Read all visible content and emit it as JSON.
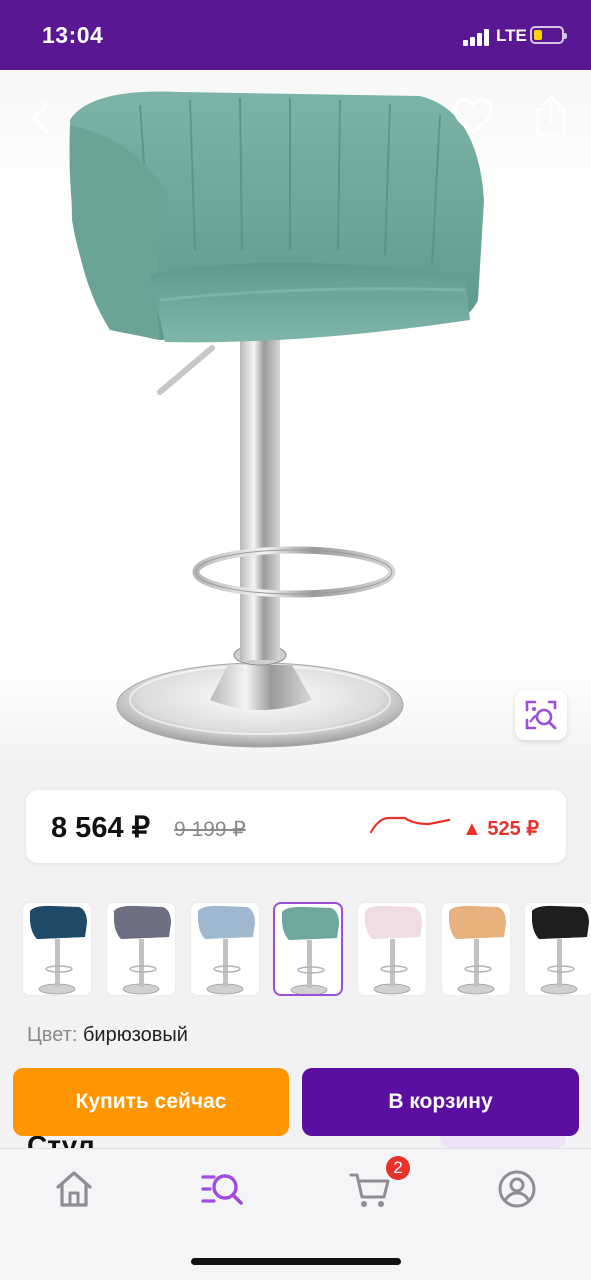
{
  "status_bar": {
    "time": "13:04",
    "network": "LTE",
    "battery_level": 0.25,
    "battery_color": "#f7d500",
    "icons": [
      "signal-icon",
      "battery-icon"
    ]
  },
  "header": {
    "background": "#5a1794",
    "icons": [
      "chevron-left-icon",
      "heart-icon",
      "share-icon",
      "visual-search-icon"
    ]
  },
  "price": {
    "current": "8 564 ₽",
    "old": "9 199 ₽",
    "difference": "▲ 525 ₽",
    "trend_color": "#e8322c"
  },
  "variants": [
    {
      "color_name": "dark-blue",
      "color": "#1f4a68",
      "selected": false
    },
    {
      "color_name": "grey",
      "color": "#6f6f82",
      "selected": false
    },
    {
      "color_name": "light-blue",
      "color": "#9fb8cf",
      "selected": false
    },
    {
      "color_name": "turquoise",
      "color": "#6ea89d",
      "selected": true
    },
    {
      "color_name": "pink",
      "color": "#f0dde4",
      "selected": false
    },
    {
      "color_name": "beige",
      "color": "#e7b27d",
      "selected": false
    },
    {
      "color_name": "black",
      "color": "#1e1e1e",
      "selected": false
    }
  ],
  "color_info": {
    "label": "Цвет:",
    "value": "бирюзовый"
  },
  "actions": {
    "buy_now": "Купить сейчас",
    "add_to_cart": "В корзину",
    "buy_color": "#ff9500",
    "cart_color": "#5a0fa0"
  },
  "product": {
    "title_peek": "Стул"
  },
  "tabbar": {
    "tabs": [
      {
        "name": "home",
        "icon": "home-icon",
        "active": false
      },
      {
        "name": "catalog-search",
        "icon": "search-list-icon",
        "active": true
      },
      {
        "name": "cart",
        "icon": "cart-icon",
        "active": false
      },
      {
        "name": "profile",
        "icon": "profile-icon",
        "active": false
      }
    ],
    "cart_badge": "2",
    "active_color": "#a24be0"
  }
}
